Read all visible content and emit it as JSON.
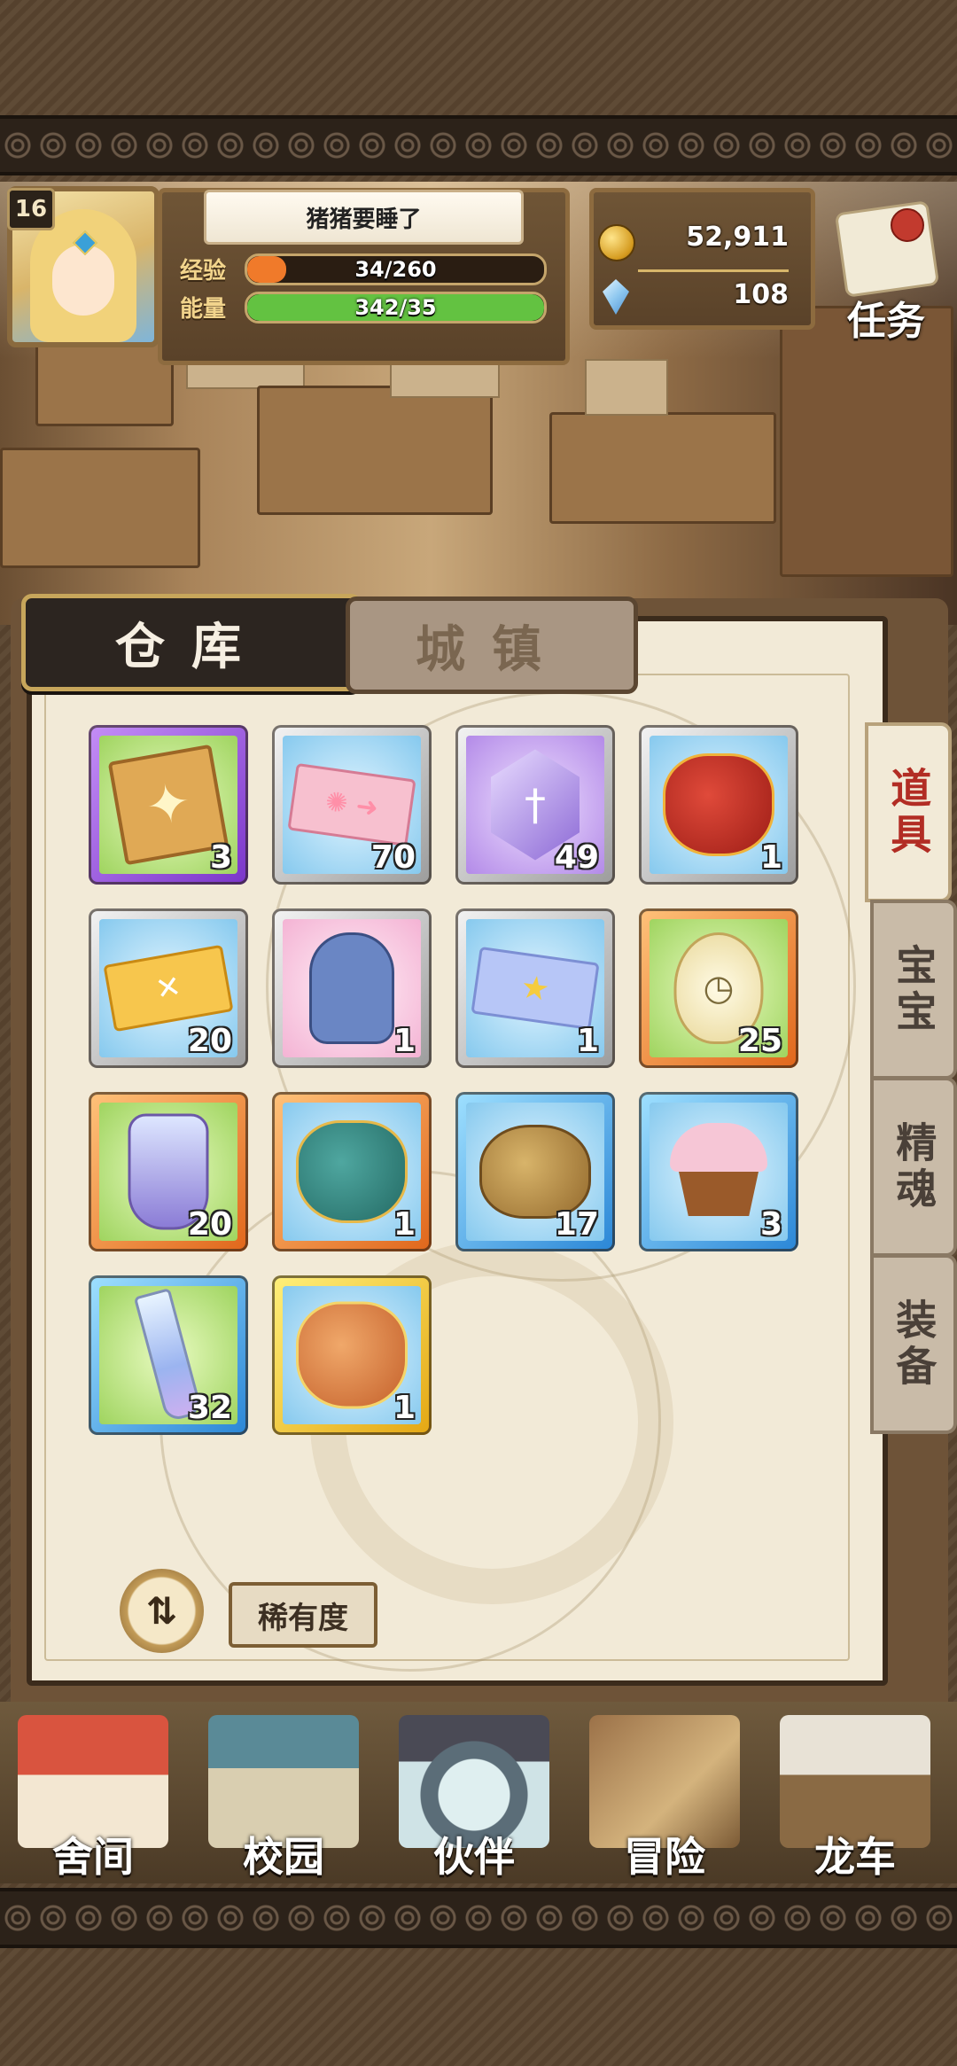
{
  "hud": {
    "level": "16",
    "player_name": "猪猪要睡了",
    "exp_label": "经验",
    "exp_value": "34/260",
    "exp_progress": 0.13,
    "energy_label": "能量",
    "energy_value": "342/35",
    "energy_progress": 1.0,
    "gold": "52,911",
    "gems": "108",
    "task_label": "任务"
  },
  "tabs": {
    "warehouse": "仓库",
    "town": "城镇"
  },
  "side_tabs": [
    {
      "label": "道具",
      "active": true
    },
    {
      "label": "宝宝",
      "active": false
    },
    {
      "label": "精魂",
      "active": false
    },
    {
      "label": "装备",
      "active": false
    }
  ],
  "items": [
    {
      "name": "star-book",
      "qty": "3",
      "frame": "purple",
      "bg": "green"
    },
    {
      "name": "pink-ticket",
      "qty": "70",
      "frame": "silver",
      "bg": "blue"
    },
    {
      "name": "sword-crystal",
      "qty": "49",
      "frame": "silver",
      "bg": "purple"
    },
    {
      "name": "red-fortune-bag",
      "qty": "1",
      "frame": "silver",
      "bg": "blue"
    },
    {
      "name": "gold-wing-ticket",
      "qty": "20",
      "frame": "silver",
      "bg": "blue"
    },
    {
      "name": "cat-doll",
      "qty": "1",
      "frame": "silver",
      "bg": "pink"
    },
    {
      "name": "blue-star-ticket",
      "qty": "1",
      "frame": "silver",
      "bg": "blue"
    },
    {
      "name": "angel-clock-egg",
      "qty": "25",
      "frame": "orange",
      "bg": "green"
    },
    {
      "name": "potion-bottle",
      "qty": "20",
      "frame": "orange",
      "bg": "green"
    },
    {
      "name": "teal-coin-bag",
      "qty": "1",
      "frame": "orange",
      "bg": "blue"
    },
    {
      "name": "gold-coin-sack",
      "qty": "17",
      "frame": "blue",
      "bg": "blue"
    },
    {
      "name": "cupcake",
      "qty": "3",
      "frame": "blue",
      "bg": "blue"
    },
    {
      "name": "test-tube",
      "qty": "32",
      "frame": "blue",
      "bg": "green"
    },
    {
      "name": "gift-pouch",
      "qty": "1",
      "frame": "gold",
      "bg": "blue"
    }
  ],
  "controls": {
    "sort_icon": "⇅",
    "rarity_label": "稀有度"
  },
  "nav": [
    {
      "label": "舍间"
    },
    {
      "label": "校园"
    },
    {
      "label": "伙伴"
    },
    {
      "label": "冒险"
    },
    {
      "label": "龙车"
    }
  ],
  "colors": {
    "exp_fill": "#f07a2a",
    "energy_fill": "#63c241",
    "active_side_tab_text": "#b22d24"
  }
}
